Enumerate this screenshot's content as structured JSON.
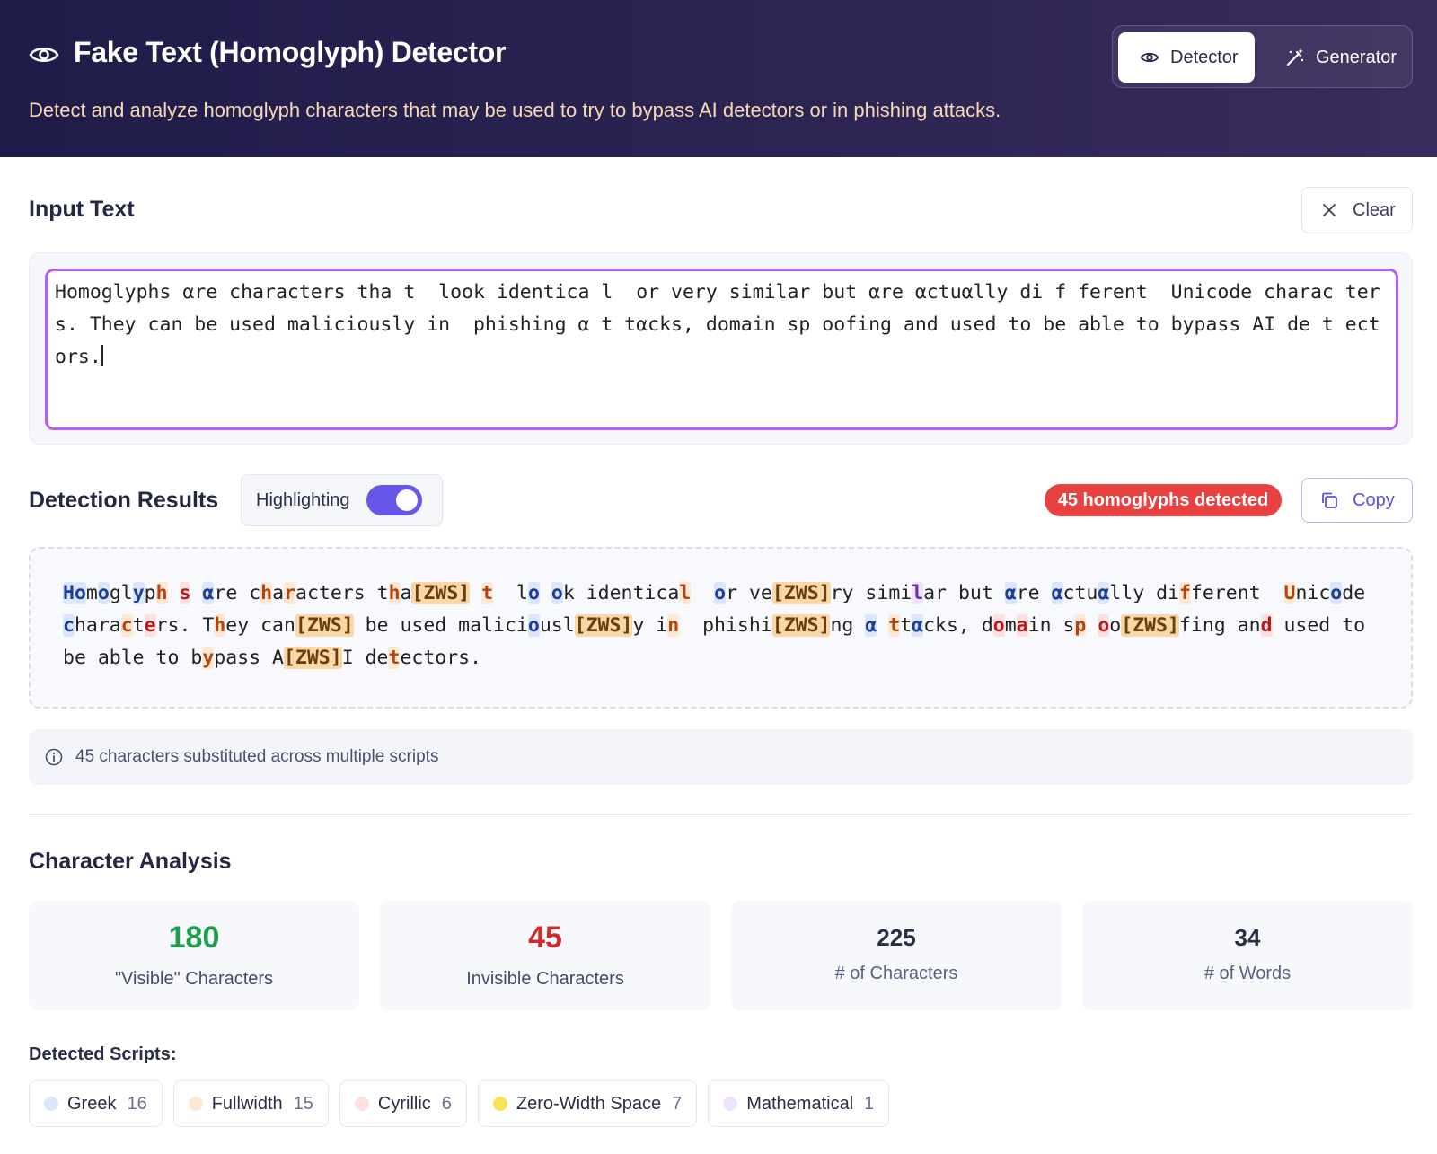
{
  "header": {
    "title": "Fake Text (Homoglyph) Detector",
    "subtitle": "Detect and analyze homoglyph characters that may be used to try to bypass AI detectors or in phishing attacks.",
    "modes": {
      "detector": "Detector",
      "generator": "Generator",
      "active": "Detector"
    }
  },
  "input": {
    "heading": "Input Text",
    "clear_label": "Clear",
    "text": "Homoglyphs αre characters tha t  look identica l  or very similar but αre αctuαlly di f ferent  Unicode charac ters. They can be used maliciously in  phishing α t tαcks, domain sp oofing and used to be able to bypass AI de t ectors."
  },
  "results": {
    "heading": "Detection Results",
    "highlighting_label": "Highlighting",
    "highlighting_on": true,
    "badge": "45 homoglyphs detected",
    "copy_label": "Copy",
    "info": "45 characters substituted across multiple scripts",
    "colors": {
      "greek": "#dbe6fb",
      "fullwidth": "#fde8d6",
      "cyrillic": "#fde0e0",
      "zero_width": "#f9d7a8",
      "mathematical": "#ede4fb"
    },
    "segments": [
      [
        "H",
        "g"
      ],
      [
        "o",
        "g"
      ],
      [
        "m",
        ""
      ],
      [
        "o",
        "g"
      ],
      [
        "gl",
        ""
      ],
      [
        "y",
        "g"
      ],
      [
        "p",
        ""
      ],
      [
        "h",
        "f"
      ],
      [
        " ",
        ""
      ],
      [
        "s",
        "c"
      ],
      [
        " ",
        ""
      ],
      [
        "α",
        "g"
      ],
      [
        "re c",
        ""
      ],
      [
        "h",
        "f"
      ],
      [
        "a",
        ""
      ],
      [
        "r",
        "f"
      ],
      [
        "acters t",
        ""
      ],
      [
        "h",
        "f"
      ],
      [
        "a",
        ""
      ],
      [
        "[ZWS]",
        "z"
      ],
      [
        " ",
        ""
      ],
      [
        "t",
        "f"
      ],
      [
        "  l",
        ""
      ],
      [
        "o",
        "g"
      ],
      [
        " ",
        ""
      ],
      [
        "o",
        "g"
      ],
      [
        "k identica",
        ""
      ],
      [
        "l",
        "f"
      ],
      [
        "  ",
        ""
      ],
      [
        "o",
        "g"
      ],
      [
        "r ve",
        ""
      ],
      [
        "[ZWS]",
        "z"
      ],
      [
        "ry simi",
        ""
      ],
      [
        "l",
        "m"
      ],
      [
        "ar but ",
        ""
      ],
      [
        "α",
        "g"
      ],
      [
        "re ",
        ""
      ],
      [
        "α",
        "g"
      ],
      [
        "ctu",
        ""
      ],
      [
        "α",
        "g"
      ],
      [
        "lly di",
        ""
      ],
      [
        "f",
        "f"
      ],
      [
        "ferent  ",
        ""
      ],
      [
        "U",
        "f"
      ],
      [
        "nic",
        ""
      ],
      [
        "o",
        "g"
      ],
      [
        "de ",
        ""
      ],
      [
        "c",
        "g"
      ],
      [
        "hara",
        ""
      ],
      [
        "c",
        "f"
      ],
      [
        "t",
        ""
      ],
      [
        "e",
        "c"
      ],
      [
        "rs. T",
        ""
      ],
      [
        "h",
        "f"
      ],
      [
        "ey can",
        ""
      ],
      [
        "[ZWS]",
        "z"
      ],
      [
        " be used malici",
        ""
      ],
      [
        "o",
        "g"
      ],
      [
        "usl",
        ""
      ],
      [
        "[ZWS]",
        "z"
      ],
      [
        "y i",
        ""
      ],
      [
        "n",
        "f"
      ],
      [
        "  phishi",
        ""
      ],
      [
        "[ZWS]",
        "z"
      ],
      [
        "ng ",
        ""
      ],
      [
        "α",
        "g"
      ],
      [
        " ",
        ""
      ],
      [
        "t",
        "f"
      ],
      [
        "t",
        ""
      ],
      [
        "α",
        "g"
      ],
      [
        "cks, d",
        ""
      ],
      [
        "o",
        "c"
      ],
      [
        "m",
        ""
      ],
      [
        "a",
        "c"
      ],
      [
        "in s",
        ""
      ],
      [
        "p",
        "f"
      ],
      [
        " ",
        ""
      ],
      [
        "o",
        "c"
      ],
      [
        "o",
        ""
      ],
      [
        "[ZWS]",
        "z"
      ],
      [
        "fing an",
        ""
      ],
      [
        "d",
        "c"
      ],
      [
        " used to be able to b",
        ""
      ],
      [
        "y",
        "f"
      ],
      [
        "pass A",
        ""
      ],
      [
        "[ZWS]",
        "z"
      ],
      [
        "I de",
        ""
      ],
      [
        "t",
        "f"
      ],
      [
        "ectors.",
        ""
      ]
    ]
  },
  "analysis": {
    "heading": "Character Analysis",
    "stats": [
      {
        "value": "180",
        "label": "\"Visible\" Characters",
        "color": "#1f9d4a"
      },
      {
        "value": "45",
        "label": "Invisible Characters",
        "color": "#d22a2a"
      },
      {
        "value": "225",
        "label": "# of Characters",
        "color": "#2a2d44"
      },
      {
        "value": "34",
        "label": "# of Words",
        "color": "#2a2d44"
      }
    ],
    "scripts_label": "Detected Scripts:",
    "scripts": [
      {
        "name": "Greek",
        "count": "16",
        "dot": "#dbe6fb"
      },
      {
        "name": "Fullwidth",
        "count": "15",
        "dot": "#fde8d6"
      },
      {
        "name": "Cyrillic",
        "count": "6",
        "dot": "#fde0e0"
      },
      {
        "name": "Zero-Width Space",
        "count": "7",
        "dot": "#f7e35a"
      },
      {
        "name": "Mathematical",
        "count": "1",
        "dot": "#ede4fb"
      }
    ]
  }
}
